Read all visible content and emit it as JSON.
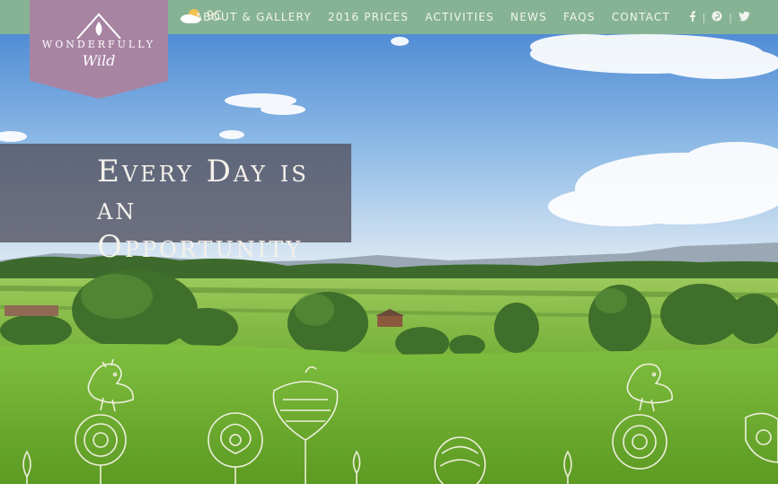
{
  "brand": {
    "name_line1": "WONDERFULLY",
    "name_line2": "Wild",
    "color": "#a884a3"
  },
  "weather": {
    "icon": "partly-cloudy-icon",
    "temperature": "9C"
  },
  "nav": {
    "items": [
      {
        "label": "About & Gallery"
      },
      {
        "label": "2016 Prices"
      },
      {
        "label": "Activities"
      },
      {
        "label": "News"
      },
      {
        "label": "FAQs"
      },
      {
        "label": "Contact"
      }
    ],
    "bar_color": "#86b394"
  },
  "social": {
    "icons": [
      "facebook-icon",
      "pinterest-icon",
      "twitter-icon"
    ],
    "facebook_glyph": "f",
    "pinterest_glyph": "℗",
    "twitter_glyph": "🐦"
  },
  "hero": {
    "tagline_line1": "Every Day is an",
    "tagline_line2": "Opportunity"
  }
}
